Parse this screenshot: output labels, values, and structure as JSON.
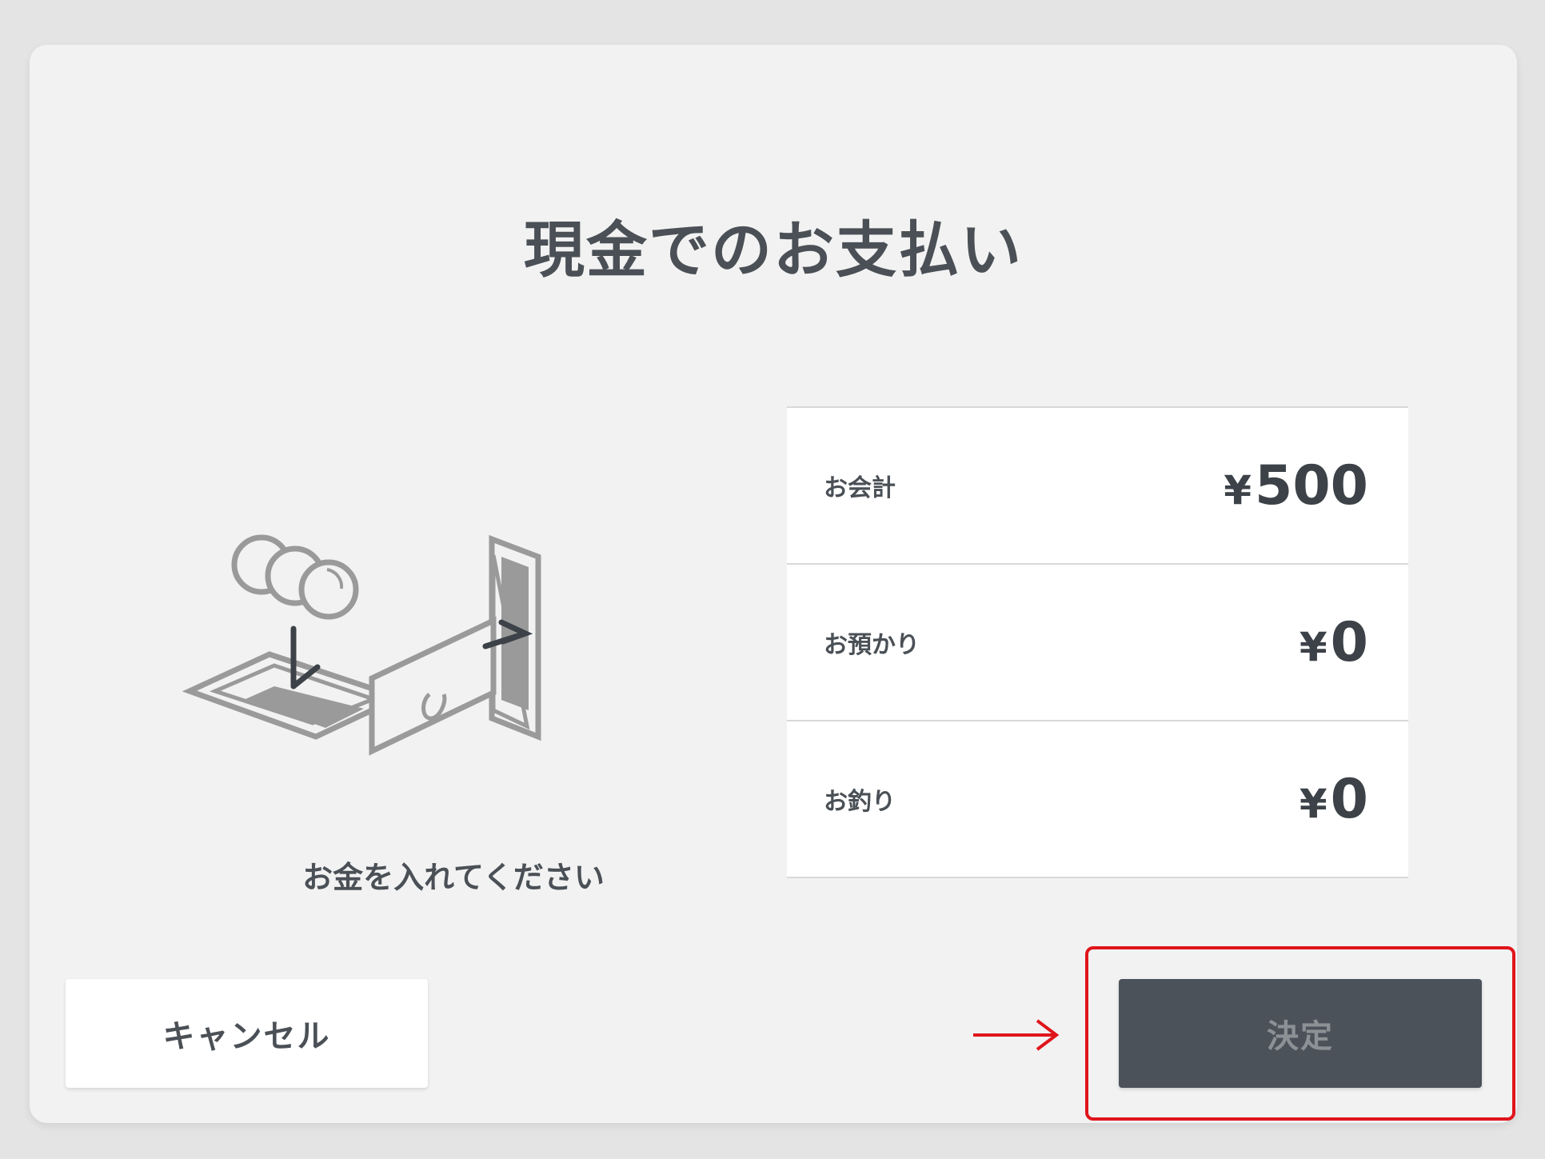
{
  "dialog": {
    "title": "現金でのお支払い",
    "instruction": "お金を入れてください"
  },
  "summary": {
    "rows": [
      {
        "label": "お会計",
        "currency": "¥",
        "amount": "500"
      },
      {
        "label": "お預かり",
        "currency": "¥",
        "amount": "0"
      },
      {
        "label": "お釣り",
        "currency": "¥",
        "amount": "0"
      }
    ]
  },
  "buttons": {
    "cancel_label": "キャンセル",
    "confirm_label": "決定"
  },
  "annotation": {
    "highlight_color": "#e0151b"
  },
  "icons": {
    "coin": "coin-slot-icon",
    "bill": "bill-slot-icon",
    "arrow": "right-arrow-icon"
  }
}
